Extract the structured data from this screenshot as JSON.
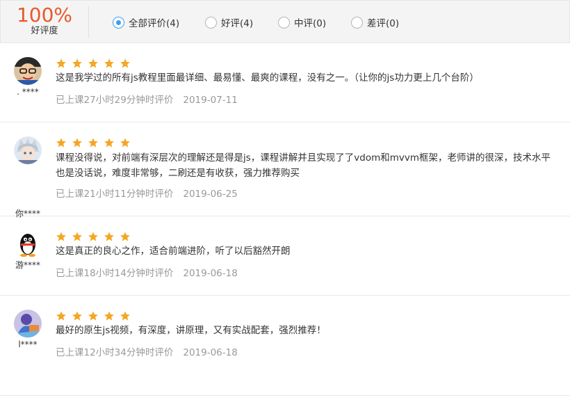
{
  "summary": {
    "score": "100%",
    "score_label": "好评度"
  },
  "filters": [
    {
      "label": "全部评价(4)",
      "checked": true
    },
    {
      "label": "好评(4)",
      "checked": false
    },
    {
      "label": "中评(0)",
      "checked": false
    },
    {
      "label": "差评(0)",
      "checked": false
    }
  ],
  "colors": {
    "accent_score": "#e8592b",
    "radio_checked": "#3d9df0",
    "star": "#f5a623",
    "meta_text": "#999999"
  },
  "reviews": [
    {
      "username": ". ****",
      "avatar": "cartoon-face-avatar",
      "rating": 5,
      "text": "这是我学过的所有js教程里面最详细、最易懂、最爽的课程，没有之一。（让你的js功力更上几个台阶）",
      "study_time": "已上课27小时29分钟时评价",
      "date": "2019-07-11"
    },
    {
      "username": "你****",
      "avatar": "anime-character-avatar",
      "rating": 5,
      "text": "课程没得说，对前端有深层次的理解还是得是js，课程讲解并且实现了了vdom和mvvm框架，老师讲的很深，技术水平也是没话说，难度非常够，二刷还是有收获，强力推荐购买",
      "study_time": "已上课21小时11分钟时评价",
      "date": "2019-06-25"
    },
    {
      "username": "游****",
      "avatar": "penguin-avatar",
      "rating": 5,
      "text": "这是真正的良心之作，适合前端进阶，听了以后豁然开朗",
      "study_time": "已上课18小时14分钟时评价",
      "date": "2019-06-18"
    },
    {
      "username": "l****",
      "avatar": "illustration-avatar",
      "rating": 5,
      "text": "最好的原生js视频，有深度，讲原理，又有实战配套，强烈推荐！",
      "study_time": "已上课12小时34分钟时评价",
      "date": "2019-06-18"
    }
  ]
}
